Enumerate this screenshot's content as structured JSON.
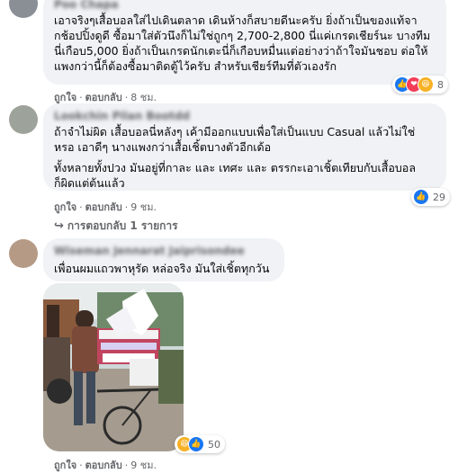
{
  "colors": {
    "bubble_bg": "#f0f2f5",
    "secondary_text": "#65676b",
    "like_blue": "#1877f2",
    "love_red": "#f33e58",
    "haha_yellow": "#f7b125"
  },
  "comments": [
    {
      "author": "Poo Chapa",
      "lines": [
        "เอาจริงๆเสื้อบอลใส่ไปเดินตลาด เดินห้างก็สบายดีนะครับ ยิ่งถ้าเป็นของแท้จา",
        "กช้อปปิ้งดูดี ซื้อมาใส่ตัวนึงก็ไม่ใช่ถูกๆ 2,700-2,800 นี่แค่เกรดเชียร์นะ บางทีม",
        "นี่เกือบ5,000 ยิ่งถ้าเป็นเกรดนักเตะนี่ก็เกือบหมื่นแต่อย่างว่าถ้าใจมันชอบ ต่อให้",
        "แพงกว่านี้ก็ต้องซื้อมาติดตู้ไว้ครับ สำหรับเชียร์ทีมที่ตัวเองรัก"
      ],
      "like_label": "ถูกใจ",
      "reply_label": "ตอบกลับ",
      "time": "8 ชม.",
      "reaction_icons": [
        "like-icon",
        "love-icon",
        "haha-icon"
      ],
      "reaction_count": "8"
    },
    {
      "author": "Lookchin Pilan Bootdd",
      "lines": [
        "ถ้าจำไม่ผิด เสื้อบอลนี่หลังๆ เค้ามีออกแบบเพื่อใส่เป็นแบบ Casual แล้วไม่ใช่",
        "หรอ เอาดีๆ นางแพงกว่าเสื้อเชิ้ตบางตัวอีกเด้อ"
      ],
      "lines2": [
        "ทั้งหลายทั้งปวง มันอยู่ที่กาละ และ เทศะ และ ตรรกะเอาเชิ้ตเทียบกับเสื้อบอล",
        "ก็ผิดแต่ต้นแล้ว"
      ],
      "like_label": "ถูกใจ",
      "reply_label": "ตอบกลับ",
      "time": "9 ชม.",
      "reaction_icons": [
        "like-icon"
      ],
      "reaction_count": "29",
      "replies_link": "การตอบกลับ 1 รายการ"
    },
    {
      "author": "Wiseman Jennarat Jaiprisondee",
      "lines": [
        "เพื่อนผมแถวพาหุรัด หล่อจริง มันใส่เชิ้ตทุกวัน"
      ],
      "like_label": "ถูกใจ",
      "reply_label": "ตอบกลับ",
      "time": "9 ชม.",
      "reaction_icons": [
        "haha-icon",
        "like-icon"
      ],
      "reaction_count": "50"
    }
  ]
}
